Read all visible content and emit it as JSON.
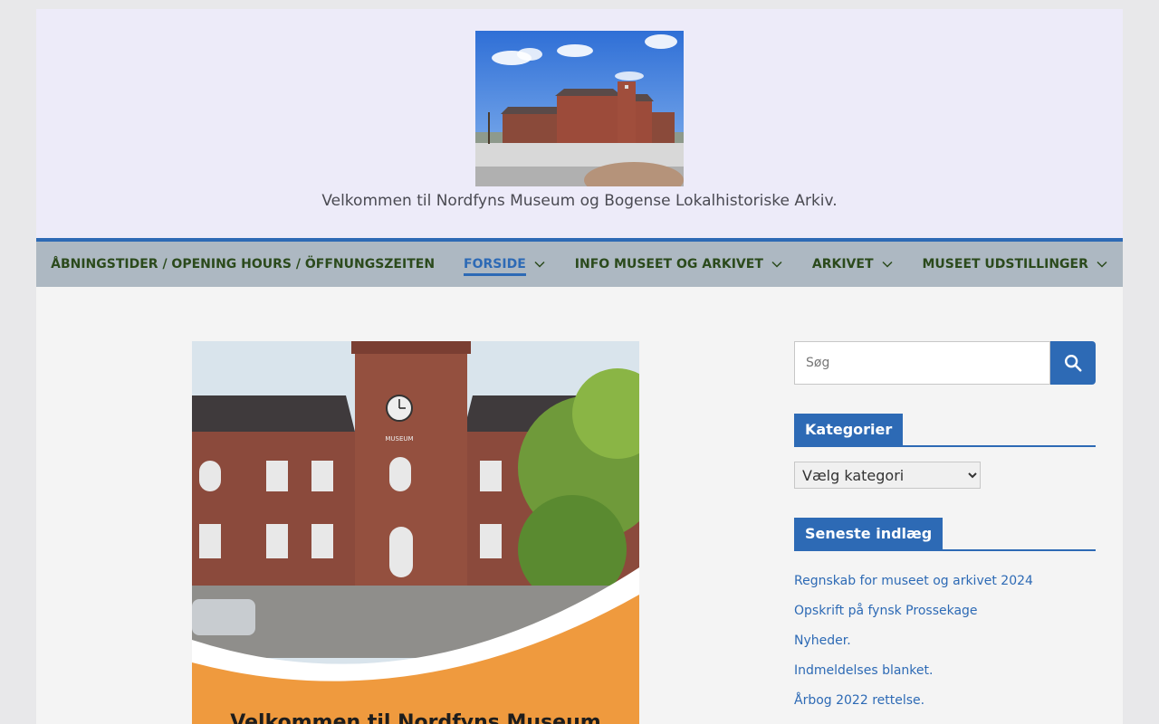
{
  "header": {
    "logo_alt": "Nordfyns Museum bygning",
    "tagline": "Velkommen til Nordfyns Museum og Bogense Lokalhistoriske Arkiv."
  },
  "nav": {
    "items": [
      {
        "label": "ÅBNINGSTIDER / OPENING HOURS / ÖFFNUNGSZEITEN",
        "has_dropdown": false,
        "active": false
      },
      {
        "label": "FORSIDE",
        "has_dropdown": true,
        "active": true
      },
      {
        "label": "INFO MUSEET OG ARKIVET",
        "has_dropdown": true,
        "active": false
      },
      {
        "label": "ARKIVET",
        "has_dropdown": true,
        "active": false
      },
      {
        "label": "MUSEET UDSTILLINGER",
        "has_dropdown": true,
        "active": false
      }
    ]
  },
  "feature": {
    "sign_text": "MUSEUM",
    "caption_text": "Velkommen til Nordfyns Museum"
  },
  "sidebar": {
    "search": {
      "placeholder": "Søg",
      "value": ""
    },
    "categories": {
      "title": "Kategorier",
      "selected": "Vælg kategori"
    },
    "recent": {
      "title": "Seneste indlæg",
      "posts": [
        "Regnskab for museet og arkivet 2024",
        "Opskrift på fynsk Prossekage",
        "Nyheder.",
        "Indmeldelses blanket.",
        "Årbog 2022 rettelse."
      ]
    }
  },
  "colors": {
    "accent": "#2d6ab5",
    "nav_text": "#2b4a1c",
    "nav_bg": "#adb8c2",
    "header_bg": "#edebf9"
  }
}
